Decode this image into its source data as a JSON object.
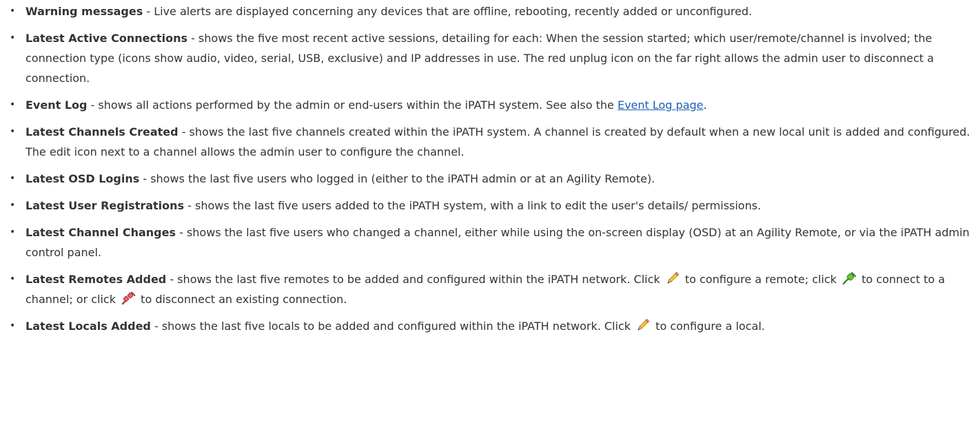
{
  "items": [
    {
      "term": "Warning messages",
      "text": " - Live alerts are displayed concerning any devices that are offline, rebooting, recently added or unconfigured."
    },
    {
      "term": "Latest Active Connections",
      "text": " - shows the five most recent active sessions, detailing for each: When the session started; which user/remote/channel is involved; the connection type (icons show audio, video, serial, USB, exclusive) and IP addresses in use. The red unplug icon on the far right allows the admin user to disconnect a connection."
    },
    {
      "term": "Event Log",
      "text": " - shows all actions performed by the admin or end-users within the iPATH system. See also the ",
      "link": "Event Log page",
      "text_after": "."
    },
    {
      "term": "Latest Channels Created",
      "text": " - shows the last five channels created within the iPATH system. A channel is created by default when a new local unit is added and configured. The edit icon next to a channel allows the admin user to configure the channel."
    },
    {
      "term": "Latest OSD Logins",
      "text": " - shows the last five users who logged in (either to the iPATH admin or at an Agility Remote)."
    },
    {
      "term": "Latest User Registrations",
      "text": " - shows the last five users added to the iPATH system, with a link to edit the user's details/ permissions."
    },
    {
      "term": "Latest Channel Changes",
      "text": " - shows the last five users who changed a channel, either while using the on-screen display (OSD) at an Agility Remote, or via the iPATH admin control panel."
    },
    {
      "term": "Latest Remotes Added",
      "text": " - shows the last five remotes to be added and configured within the iPATH network. Click ",
      "text_b": " to configure a remote; click ",
      "text_c": " to connect to a channel; or click ",
      "text_d": " to disconnect an existing connection."
    },
    {
      "term": "Latest Locals Added",
      "text": " - shows the last five locals to be added and configured within the iPATH network. Click ",
      "text_b": " to configure a local."
    }
  ],
  "icons": {
    "edit": "pencil-icon",
    "connect": "green-plug-icon",
    "disconnect": "red-unplug-icon"
  },
  "colors": {
    "link": "#1a5fb4",
    "text": "#333333"
  }
}
